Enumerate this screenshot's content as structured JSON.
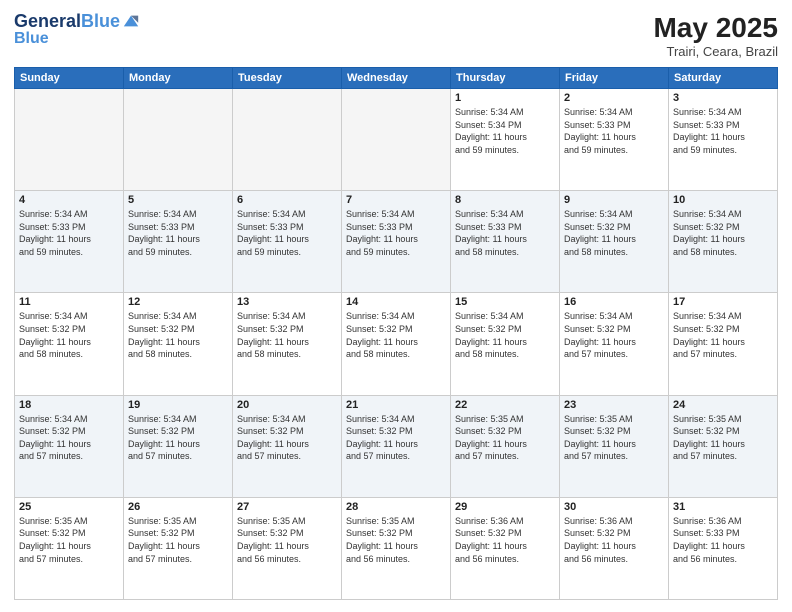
{
  "header": {
    "logo_line1": "General",
    "logo_line2": "Blue",
    "month_year": "May 2025",
    "location": "Trairi, Ceara, Brazil"
  },
  "weekdays": [
    "Sunday",
    "Monday",
    "Tuesday",
    "Wednesday",
    "Thursday",
    "Friday",
    "Saturday"
  ],
  "weeks": [
    [
      {
        "day": "",
        "info": ""
      },
      {
        "day": "",
        "info": ""
      },
      {
        "day": "",
        "info": ""
      },
      {
        "day": "",
        "info": ""
      },
      {
        "day": "1",
        "info": "Sunrise: 5:34 AM\nSunset: 5:34 PM\nDaylight: 11 hours\nand 59 minutes."
      },
      {
        "day": "2",
        "info": "Sunrise: 5:34 AM\nSunset: 5:33 PM\nDaylight: 11 hours\nand 59 minutes."
      },
      {
        "day": "3",
        "info": "Sunrise: 5:34 AM\nSunset: 5:33 PM\nDaylight: 11 hours\nand 59 minutes."
      }
    ],
    [
      {
        "day": "4",
        "info": "Sunrise: 5:34 AM\nSunset: 5:33 PM\nDaylight: 11 hours\nand 59 minutes."
      },
      {
        "day": "5",
        "info": "Sunrise: 5:34 AM\nSunset: 5:33 PM\nDaylight: 11 hours\nand 59 minutes."
      },
      {
        "day": "6",
        "info": "Sunrise: 5:34 AM\nSunset: 5:33 PM\nDaylight: 11 hours\nand 59 minutes."
      },
      {
        "day": "7",
        "info": "Sunrise: 5:34 AM\nSunset: 5:33 PM\nDaylight: 11 hours\nand 59 minutes."
      },
      {
        "day": "8",
        "info": "Sunrise: 5:34 AM\nSunset: 5:33 PM\nDaylight: 11 hours\nand 58 minutes."
      },
      {
        "day": "9",
        "info": "Sunrise: 5:34 AM\nSunset: 5:32 PM\nDaylight: 11 hours\nand 58 minutes."
      },
      {
        "day": "10",
        "info": "Sunrise: 5:34 AM\nSunset: 5:32 PM\nDaylight: 11 hours\nand 58 minutes."
      }
    ],
    [
      {
        "day": "11",
        "info": "Sunrise: 5:34 AM\nSunset: 5:32 PM\nDaylight: 11 hours\nand 58 minutes."
      },
      {
        "day": "12",
        "info": "Sunrise: 5:34 AM\nSunset: 5:32 PM\nDaylight: 11 hours\nand 58 minutes."
      },
      {
        "day": "13",
        "info": "Sunrise: 5:34 AM\nSunset: 5:32 PM\nDaylight: 11 hours\nand 58 minutes."
      },
      {
        "day": "14",
        "info": "Sunrise: 5:34 AM\nSunset: 5:32 PM\nDaylight: 11 hours\nand 58 minutes."
      },
      {
        "day": "15",
        "info": "Sunrise: 5:34 AM\nSunset: 5:32 PM\nDaylight: 11 hours\nand 58 minutes."
      },
      {
        "day": "16",
        "info": "Sunrise: 5:34 AM\nSunset: 5:32 PM\nDaylight: 11 hours\nand 57 minutes."
      },
      {
        "day": "17",
        "info": "Sunrise: 5:34 AM\nSunset: 5:32 PM\nDaylight: 11 hours\nand 57 minutes."
      }
    ],
    [
      {
        "day": "18",
        "info": "Sunrise: 5:34 AM\nSunset: 5:32 PM\nDaylight: 11 hours\nand 57 minutes."
      },
      {
        "day": "19",
        "info": "Sunrise: 5:34 AM\nSunset: 5:32 PM\nDaylight: 11 hours\nand 57 minutes."
      },
      {
        "day": "20",
        "info": "Sunrise: 5:34 AM\nSunset: 5:32 PM\nDaylight: 11 hours\nand 57 minutes."
      },
      {
        "day": "21",
        "info": "Sunrise: 5:34 AM\nSunset: 5:32 PM\nDaylight: 11 hours\nand 57 minutes."
      },
      {
        "day": "22",
        "info": "Sunrise: 5:35 AM\nSunset: 5:32 PM\nDaylight: 11 hours\nand 57 minutes."
      },
      {
        "day": "23",
        "info": "Sunrise: 5:35 AM\nSunset: 5:32 PM\nDaylight: 11 hours\nand 57 minutes."
      },
      {
        "day": "24",
        "info": "Sunrise: 5:35 AM\nSunset: 5:32 PM\nDaylight: 11 hours\nand 57 minutes."
      }
    ],
    [
      {
        "day": "25",
        "info": "Sunrise: 5:35 AM\nSunset: 5:32 PM\nDaylight: 11 hours\nand 57 minutes."
      },
      {
        "day": "26",
        "info": "Sunrise: 5:35 AM\nSunset: 5:32 PM\nDaylight: 11 hours\nand 57 minutes."
      },
      {
        "day": "27",
        "info": "Sunrise: 5:35 AM\nSunset: 5:32 PM\nDaylight: 11 hours\nand 56 minutes."
      },
      {
        "day": "28",
        "info": "Sunrise: 5:35 AM\nSunset: 5:32 PM\nDaylight: 11 hours\nand 56 minutes."
      },
      {
        "day": "29",
        "info": "Sunrise: 5:36 AM\nSunset: 5:32 PM\nDaylight: 11 hours\nand 56 minutes."
      },
      {
        "day": "30",
        "info": "Sunrise: 5:36 AM\nSunset: 5:32 PM\nDaylight: 11 hours\nand 56 minutes."
      },
      {
        "day": "31",
        "info": "Sunrise: 5:36 AM\nSunset: 5:33 PM\nDaylight: 11 hours\nand 56 minutes."
      }
    ]
  ]
}
